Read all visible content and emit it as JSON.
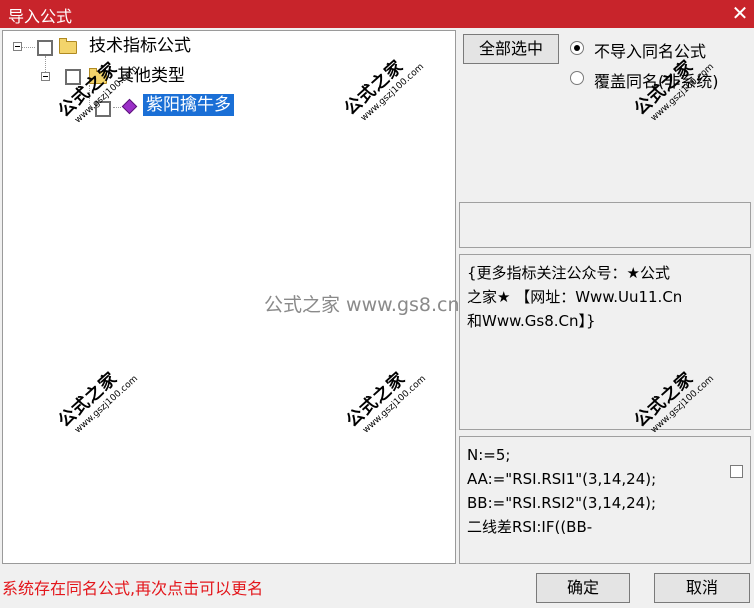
{
  "window": {
    "title": "导入公式",
    "close_glyph": "✕",
    "colors": {
      "titlebar": "#c8242b",
      "selection": "#1a6fd6",
      "status_text": "#e3161b"
    }
  },
  "tree": {
    "root": {
      "label": "技术指标公式",
      "expander": "⊟"
    },
    "group": {
      "label": "其他类型",
      "expander": "⊟"
    },
    "item": {
      "label": "紫阳擒牛多",
      "selected": true
    }
  },
  "options": {
    "select_all_label": "全部选中",
    "radio_no_import": "不导入同名公式",
    "radio_overwrite": "覆盖同名(非系统)",
    "selected_radio": "no_import"
  },
  "description": {
    "lines": [
      "{更多指标关注公众号：★公式",
      "之家★ 【网址：Www.Uu11.Cn",
      "和Www.Gs8.Cn】}"
    ]
  },
  "code": {
    "lines": [
      "N:=5;",
      "AA:=\"RSI.RSI1\"(3,14,24);",
      "BB:=\"RSI.RSI2\"(3,14,24);",
      "二线差RSI:IF((BB-"
    ]
  },
  "footer": {
    "status": "系统存在同名公式,再次点击可以更名",
    "ok_label": "确定",
    "cancel_label": "取消"
  },
  "watermarks": {
    "brand": "公式之家",
    "site": "www.gszj100.com",
    "center": "公式之家 www.gs8.cn"
  }
}
